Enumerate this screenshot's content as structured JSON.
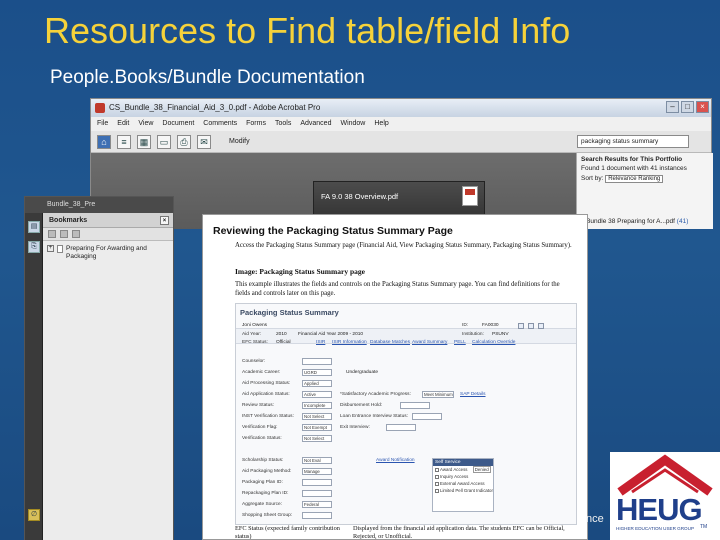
{
  "slide": {
    "title": "Resources to Find table/field Info",
    "subtitle": "People.Books/Bundle Documentation",
    "corner_text": "nce"
  },
  "acrobat": {
    "window_title": "CS_Bundle_38_Financial_Aid_3_0.pdf - Adobe Acrobat Pro",
    "menus": [
      "File",
      "Edit",
      "View",
      "Document",
      "Comments",
      "Forms",
      "Tools",
      "Advanced",
      "Window",
      "Help"
    ],
    "modify_label": "Modify",
    "search_value": "packaging status summary",
    "portfolio_file": "FA 9.0 38 Overview.pdf",
    "search_panel": {
      "title": "Search Results for This Portfolio",
      "found_line": "Found 1 document with 41 instances",
      "sort_label": "Sort by:",
      "sort_value": "Relevance Ranking",
      "result_text": "Bundle 38 Preparing for A...pdf",
      "result_count": "(41)"
    }
  },
  "bookmarks_window": {
    "title": "Bundle_38_Pre",
    "panel_title": "Bookmarks",
    "item_label": "Preparing For Awarding and Packaging"
  },
  "document": {
    "heading": "Reviewing the Packaging Status Summary Page",
    "para1": "Access the Packaging Status Summary page (Financial Aid, View Packaging Status Summary, Packaging Status Summary).",
    "image_caption": "Image: Packaging Status Summary page",
    "para2": "This example illustrates the fields and controls on the Packaging Status Summary page. You can find definitions for the fields and controls later on this page.",
    "screen": {
      "title": "Packaging Status Summary",
      "header": {
        "name_value": "Joni Owens",
        "id_label": "ID:",
        "id_value": "FA0030",
        "aid_year_label": "Aid Year:",
        "aid_year_value": "2010",
        "aid_year_desc": "Financial Aid Year 2009 - 2010",
        "institution_label": "Institution:",
        "institution_value": "PSUNV",
        "efc_status_label": "EFC Status:",
        "efc_status_value": "Official",
        "links": [
          "ISIR",
          "ISIR Information",
          "Database Matches",
          "Award Summary",
          "PELL",
          "Calculation Override"
        ]
      },
      "left_fields": [
        {
          "label": "Counselor:",
          "value": ""
        },
        {
          "label": "Academic Career:",
          "value": "UGRD",
          "extra": "Undergraduate"
        },
        {
          "label": "Aid Processing Status:",
          "value": "Applied"
        },
        {
          "label": "Aid Application Status:",
          "value": "Active"
        },
        {
          "label": "Review Status:",
          "value": "Incomplete"
        },
        {
          "label": "INST Verification Status:",
          "value": "Not Select"
        },
        {
          "label": "Verification Flag:",
          "value": "Not Exempt"
        },
        {
          "label": "Verification Status:",
          "value": "Not Select"
        }
      ],
      "right_fields": [
        {
          "label": "*Satisfactory Academic Progress:",
          "value": "Meet Minimum",
          "link": "SAP Details"
        },
        {
          "label": "Disbursement Hold:",
          "value": ""
        },
        {
          "label": "Loan Entrance Interview Status:",
          "value": ""
        },
        {
          "label": "Exit Interview:",
          "value": ""
        }
      ],
      "lower_fields": [
        {
          "label": "Scholarship Status:",
          "value": "Not Eval"
        },
        {
          "label": "Aid Packaging Method:",
          "value": "Manage"
        },
        {
          "label": "Packaging Plan ID:",
          "value": ""
        },
        {
          "label": "Repackaging Plan ID:",
          "value": ""
        },
        {
          "label": "Aggregate Source:",
          "value": "Federal"
        },
        {
          "label": "Shopping Sheet Group:",
          "value": ""
        }
      ],
      "award_link": "Award Notification",
      "self_service": {
        "title": "Self Service",
        "award_access_label": "Award Access",
        "award_access_value": "Denied",
        "rows": [
          "Inquiry Access",
          "External Award Access",
          "Limited Pell Grant Indicator"
        ]
      }
    },
    "bottom_left": "EFC Status (expected family contribution status)",
    "bottom_right": "Displayed from the financial aid application data. The students EFC can be Official, Rejected, or Unofficial."
  },
  "logo": {
    "text": "HEUG",
    "tagline": "HIGHER EDUCATION USER GROUP",
    "tm": "TM",
    "colors": {
      "red": "#c8202f",
      "blue": "#1f3f8a"
    }
  }
}
